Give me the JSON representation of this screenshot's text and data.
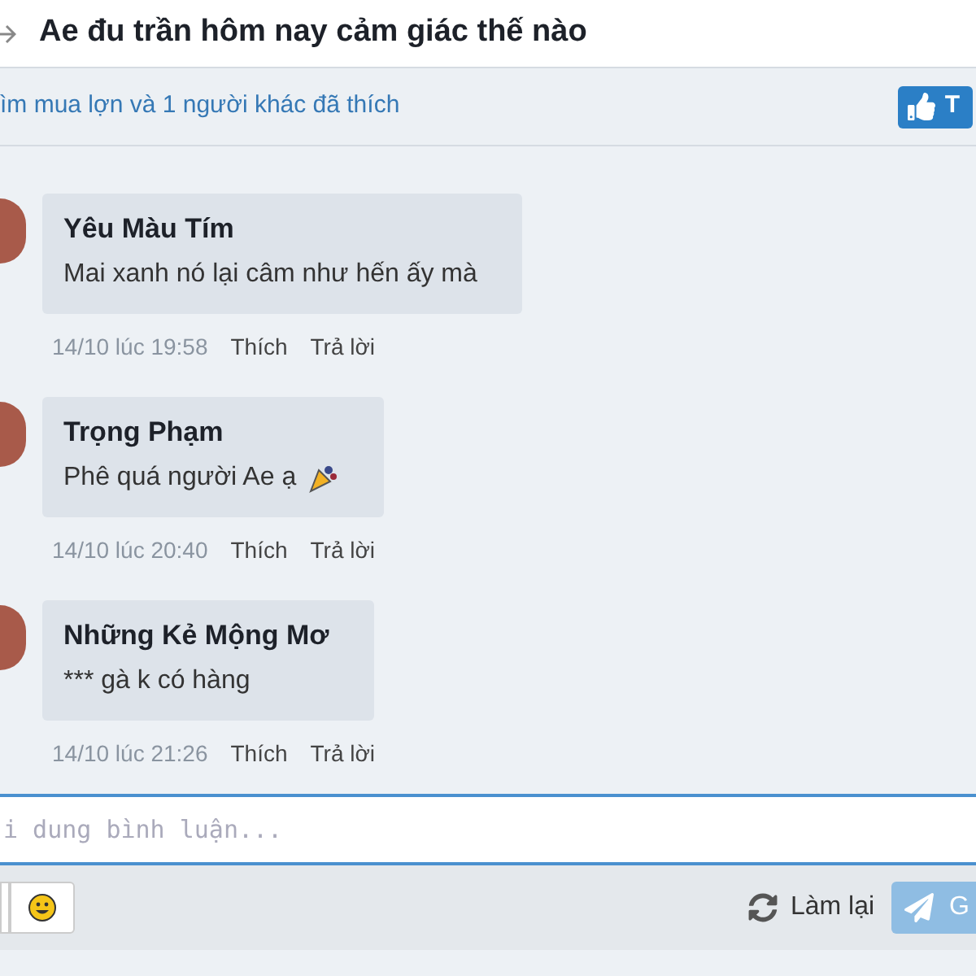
{
  "header": {
    "title": "Ae đu trần hôm nay cảm giác thế nào"
  },
  "likes_bar": {
    "text": "ìm mua lợn và 1 người khác đã thích",
    "like_button": "T"
  },
  "comments": [
    {
      "author": "Yêu Màu Tím",
      "text": "Mai xanh nó lại câm như hến ấy mà",
      "time": "14/10 lúc 19:58",
      "like": "Thích",
      "reply": "Trả lời",
      "emoji": false
    },
    {
      "author": "Trọng Phạm",
      "text": "Phê quá người Ae ạ",
      "time": "14/10 lúc 20:40",
      "like": "Thích",
      "reply": "Trả lời",
      "emoji": true
    },
    {
      "author": "Những Kẻ Mộng Mơ",
      "text": "*** gà k có hàng",
      "time": "14/10 lúc 21:26",
      "like": "Thích",
      "reply": "Trả lời",
      "emoji": false
    }
  ],
  "composer": {
    "placeholder": "i dung bình luận...",
    "reset": "Làm lại",
    "send": "G"
  }
}
